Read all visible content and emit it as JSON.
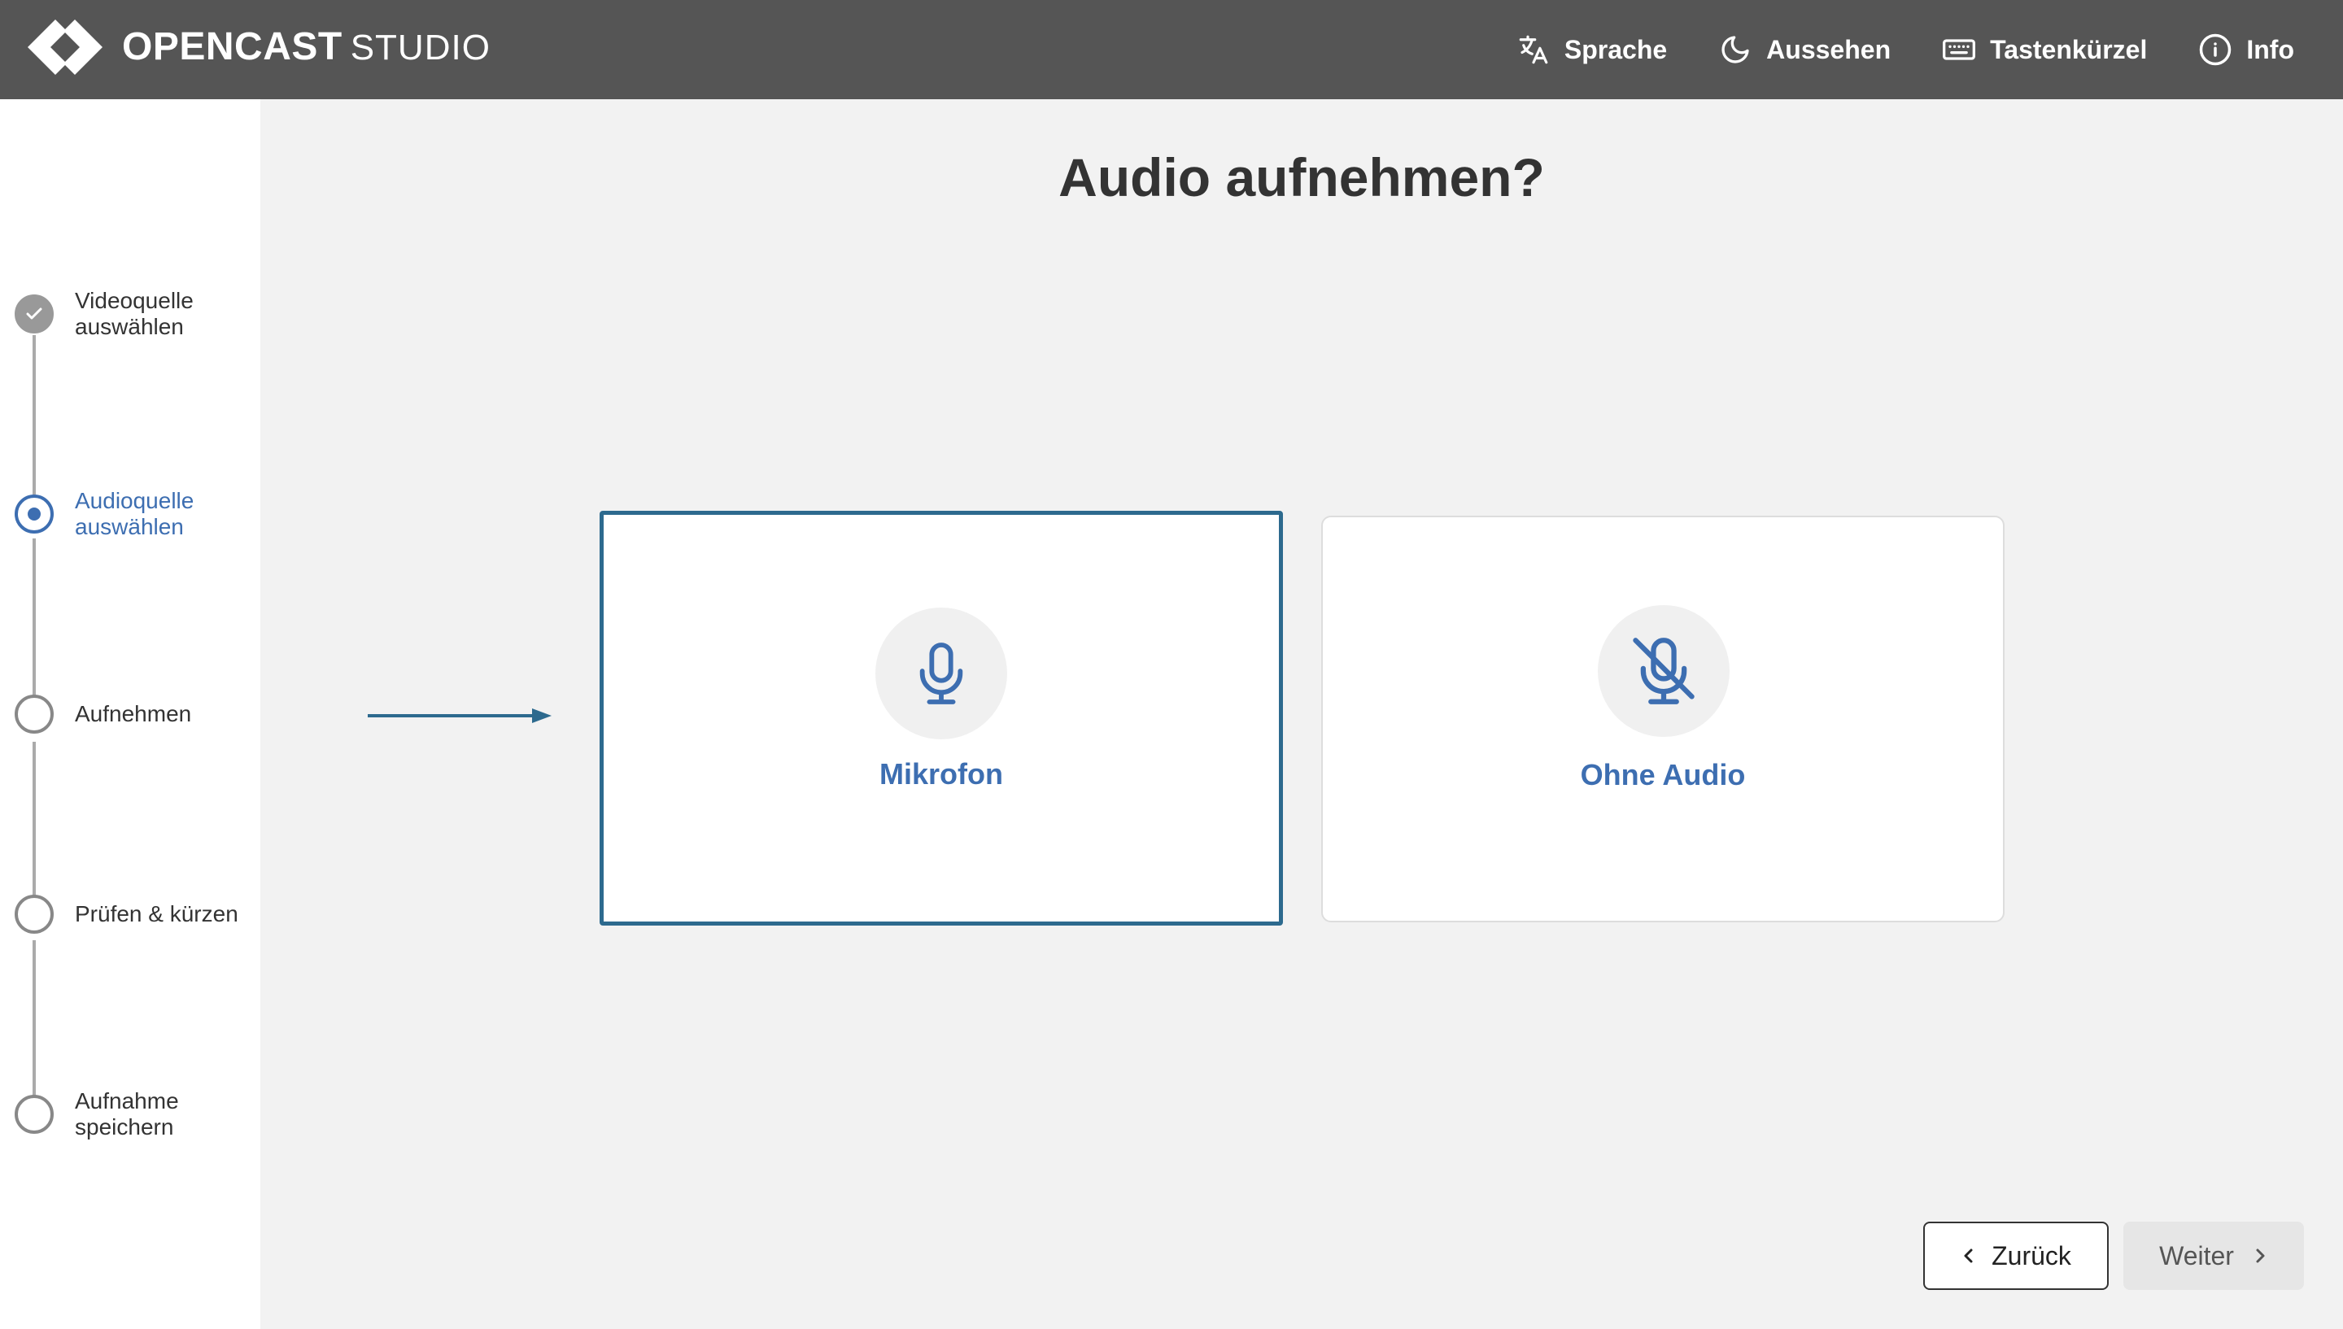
{
  "header": {
    "logo_main": "OPENCAST",
    "logo_sub": "STUDIO",
    "nav": [
      {
        "label": "Sprache",
        "icon": "translate-icon"
      },
      {
        "label": "Aussehen",
        "icon": "moon-icon"
      },
      {
        "label": "Tastenkürzel",
        "icon": "keyboard-icon"
      },
      {
        "label": "Info",
        "icon": "info-icon"
      }
    ]
  },
  "steps": [
    {
      "label": "Videoquelle auswählen",
      "state": "done"
    },
    {
      "label": "Audioquelle auswählen",
      "state": "active"
    },
    {
      "label": "Aufnehmen",
      "state": "pending"
    },
    {
      "label": "Prüfen & kürzen",
      "state": "pending"
    },
    {
      "label": "Aufnahme speichern",
      "state": "pending"
    }
  ],
  "main": {
    "title": "Audio aufnehmen?",
    "options": [
      {
        "label": "Mikrofon",
        "icon": "microphone-icon",
        "selected": true
      },
      {
        "label": "Ohne Audio",
        "icon": "microphone-off-icon",
        "selected": false
      }
    ]
  },
  "buttons": {
    "back": "Zurück",
    "next": "Weiter"
  },
  "colors": {
    "header_bg": "#555555",
    "accent": "#3d6eb1",
    "selected_border": "#2d6a8e",
    "page_bg": "#f2f2f2"
  }
}
